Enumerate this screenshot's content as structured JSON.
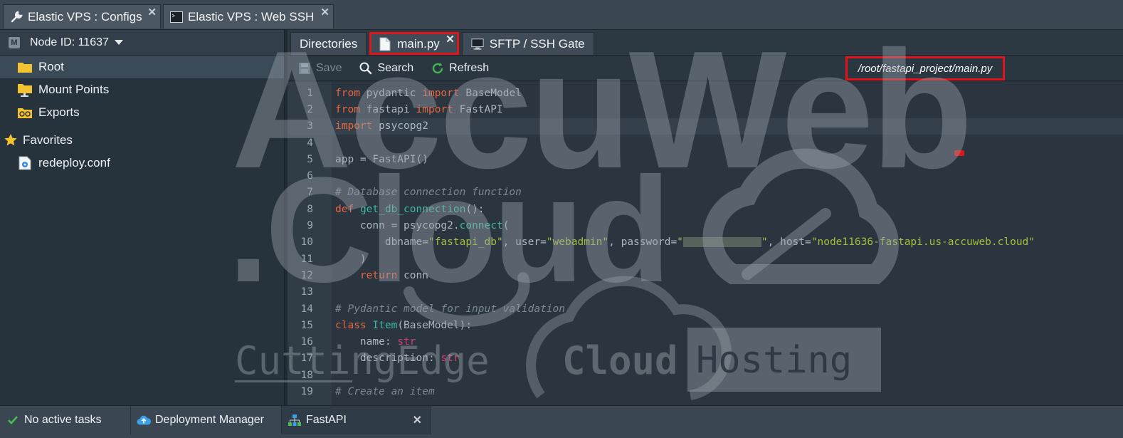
{
  "window_tabs": [
    {
      "label": "Elastic VPS : Configs",
      "icon": "wrench-icon"
    },
    {
      "label": "Elastic VPS : Web SSH",
      "icon": "terminal-icon"
    }
  ],
  "left_panel": {
    "node_label": "Node ID: 11637",
    "tree": [
      {
        "label": "Root",
        "icon": "folder-icon",
        "selected": true
      },
      {
        "label": "Mount Points",
        "icon": "mount-folder-icon"
      },
      {
        "label": "Exports",
        "icon": "exports-folder-icon"
      }
    ],
    "favorites_label": "Favorites",
    "favorites": [
      {
        "label": "redeploy.conf",
        "icon": "config-file-icon"
      }
    ]
  },
  "editor_tabs": [
    {
      "label": "Directories"
    },
    {
      "label": "main.py",
      "icon": "file-icon",
      "closable": true,
      "highlighted": true
    },
    {
      "label": "SFTP / SSH Gate",
      "icon": "monitor-icon"
    }
  ],
  "toolbar": {
    "save_label": "Save",
    "search_label": "Search",
    "refresh_label": "Refresh",
    "file_path": "/root/fastapi_project/main.py"
  },
  "code": {
    "line_numbers": [
      "1",
      "2",
      "3",
      "4",
      "5",
      "6",
      "7",
      "8",
      "9",
      "10",
      "11",
      "12",
      "13",
      "14",
      "15",
      "16",
      "17",
      "18",
      "19"
    ],
    "l1": {
      "a": "from",
      "b": " pydantic ",
      "c": "import",
      "d": " BaseModel"
    },
    "l2": {
      "a": "from",
      "b": " fastapi ",
      "c": "import",
      "d": " FastAPI"
    },
    "l3": {
      "a": "import",
      "b": " psycopg2"
    },
    "l5": {
      "a": "app = FastAPI()"
    },
    "l7": {
      "a": "# Database connection function"
    },
    "l8": {
      "a": "def",
      "b": " ",
      "c": "get_db_connection",
      "d": "():"
    },
    "l9": {
      "a": "    conn = psycopg2.",
      "b": "connect",
      "c": "("
    },
    "l10": {
      "a": "        dbname=",
      "b": "\"fastapi_db\"",
      "c": ", user=",
      "d": "\"webadmin\"",
      "e": ", password=",
      "f": "\"",
      "g": "\"",
      "h": ", host=",
      "i": "\"node11636-fastapi.us-accuweb.cloud\""
    },
    "l11": {
      "a": "    )"
    },
    "l12": {
      "a": "    ",
      "b": "return",
      "c": " conn"
    },
    "l14": {
      "a": "# Pydantic model for input validation"
    },
    "l15": {
      "a": "class",
      "b": " ",
      "c": "Item",
      "d": "(BaseModel):"
    },
    "l16": {
      "a": "    name: ",
      "b": "str"
    },
    "l17": {
      "a": "    description: ",
      "b": "str"
    },
    "l19": {
      "a": "# Create an item"
    }
  },
  "statusbar": {
    "tasks_label": "No active tasks",
    "deploy_label": "Deployment Manager",
    "env_label": "FastAPI"
  },
  "watermark": {
    "brand_top": "AccuWeb",
    "brand_mid": ".Cloud",
    "tagline_1": "CuttingEdge",
    "tagline_2": "Cloud",
    "tagline_3": "Hosting"
  },
  "colors": {
    "highlight_red": "#e0141b",
    "keyword": "#e8673f",
    "function": "#3fb8a3",
    "string": "#a4be3b"
  }
}
